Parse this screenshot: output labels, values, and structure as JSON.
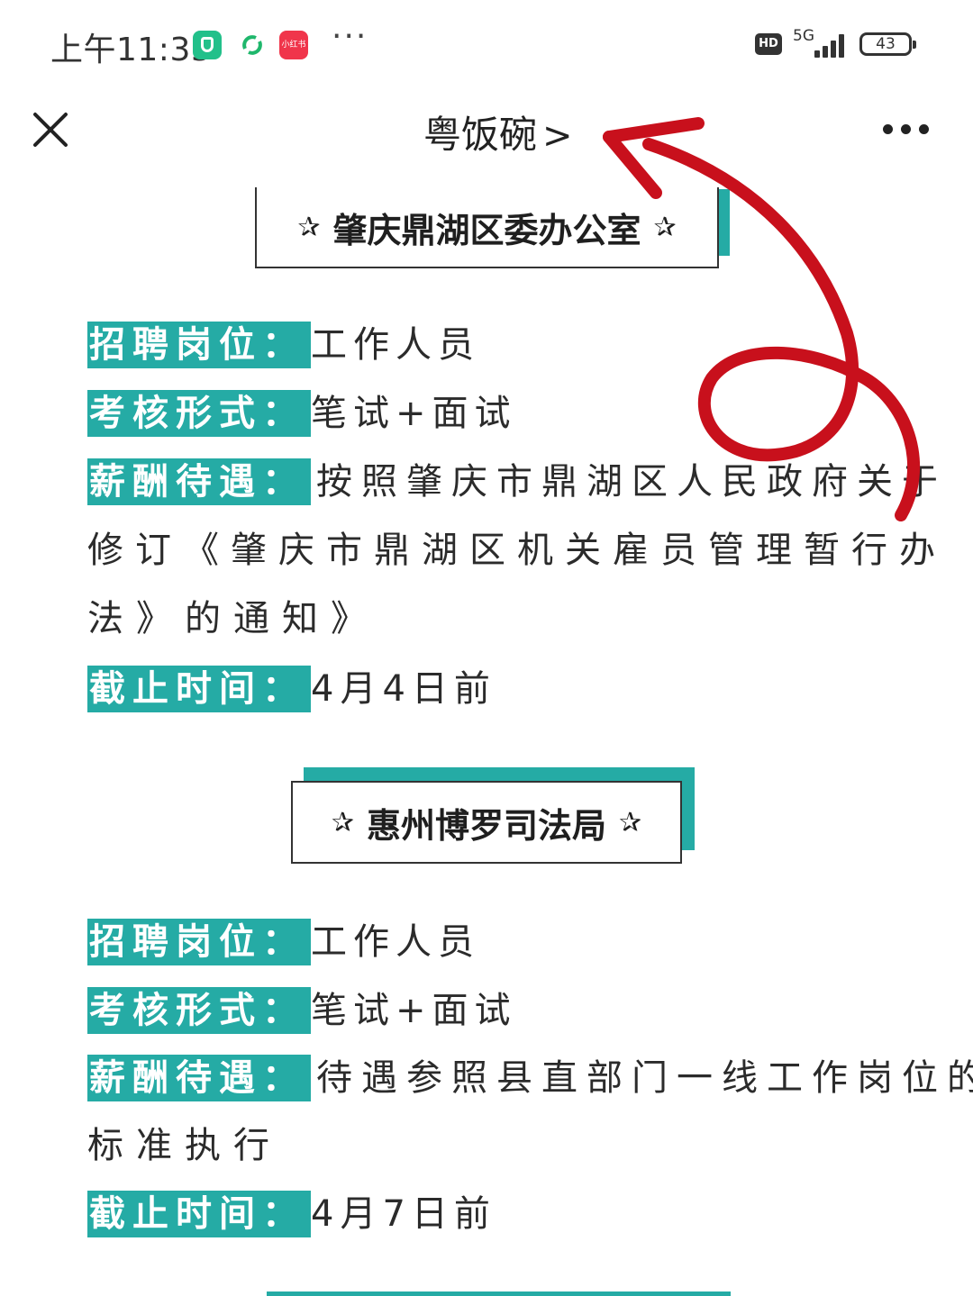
{
  "status_bar": {
    "time": "上午11:35",
    "app_badge_text": "小红书",
    "overflow": "···",
    "hd": "HD",
    "network": "5G",
    "battery": "43"
  },
  "nav": {
    "title": "粤饭碗",
    "chevron": ">"
  },
  "sections": [
    {
      "header": "肇庆鼎湖区委办公室",
      "star": "✰",
      "position_label": "招聘岗位：",
      "position_value": "工作人员",
      "exam_label": "考核形式：",
      "exam_value": "笔试+面试",
      "salary_label": "薪酬待遇：",
      "salary_line1": "按照肇庆市鼎湖区人民政府关于",
      "salary_line2": "修订《肇庆市鼎湖区机关雇员管理暂行办",
      "salary_line3": "法》的通知》",
      "deadline_label": "截止时间：",
      "deadline_value": "4月4日前"
    },
    {
      "header": "惠州博罗司法局",
      "star": "✰",
      "position_label": "招聘岗位：",
      "position_value": "工作人员",
      "exam_label": "考核形式：",
      "exam_value": "笔试+面试",
      "salary_label": "薪酬待遇：",
      "salary_line1": "待遇参照县直部门一线工作岗位的",
      "salary_line2": "标准执行",
      "deadline_label": "截止时间：",
      "deadline_value": "4月7日前"
    }
  ],
  "colors": {
    "accent": "#25aba5",
    "annotation_arrow": "#c8101c"
  }
}
